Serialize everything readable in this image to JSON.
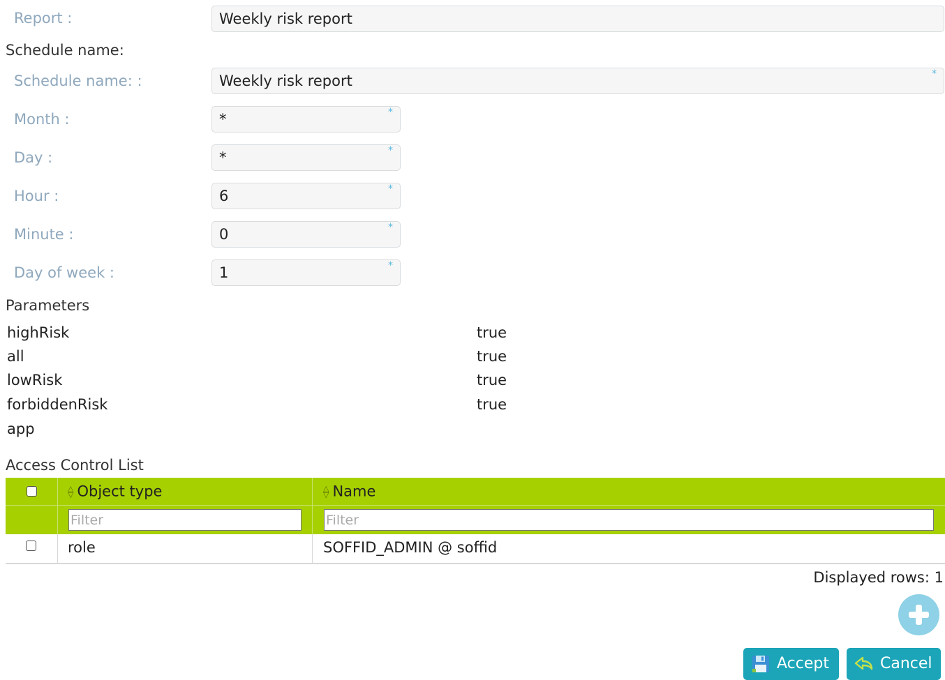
{
  "form": {
    "report_label": "Report :",
    "report_value": "Weekly risk report",
    "schedule_section": "Schedule name:",
    "schedule_name_label": "Schedule name: :",
    "schedule_name_value": "Weekly risk report",
    "month_label": "Month :",
    "month_value": "*",
    "day_label": "Day :",
    "day_value": "*",
    "hour_label": "Hour :",
    "hour_value": "6",
    "minute_label": "Minute :",
    "minute_value": "0",
    "dow_label": "Day of week :",
    "dow_value": "1",
    "required_marker": "*"
  },
  "parameters": {
    "title": "Parameters",
    "items": [
      {
        "name": "highRisk",
        "value": "true"
      },
      {
        "name": "all",
        "value": "true"
      },
      {
        "name": "lowRisk",
        "value": "true"
      },
      {
        "name": "forbiddenRisk",
        "value": "true"
      },
      {
        "name": "app",
        "value": ""
      }
    ]
  },
  "acl": {
    "title": "Access Control List",
    "columns": [
      "Object type",
      "Name"
    ],
    "filter_placeholder": "Filter",
    "rows": [
      {
        "object_type": "role",
        "name": "SOFFID_ADMIN @ soffid"
      }
    ],
    "displayed_rows": "Displayed rows: 1"
  },
  "buttons": {
    "accept": "Accept",
    "cancel": "Cancel"
  },
  "colors": {
    "header_green": "#a7d000",
    "button_teal": "#1ca5b8",
    "add_button": "#8fd1e6",
    "label_blue": "#8fa8bd"
  },
  "icons": {
    "add": "plus-circle-icon",
    "accept": "save-icon",
    "cancel": "undo-arrow-icon",
    "sort": "sort-icon"
  }
}
